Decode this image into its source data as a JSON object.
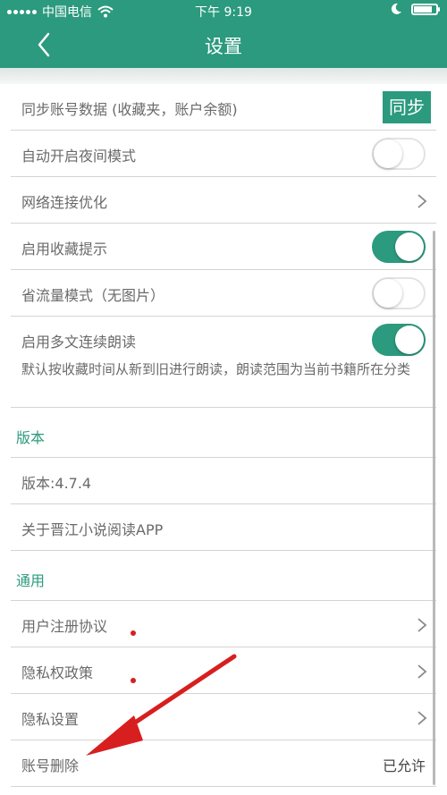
{
  "status": {
    "carrier": "中国电信",
    "time": "下午 9:19"
  },
  "nav": {
    "title": "设置"
  },
  "settings": {
    "sync_account": "同步账号数据 (收藏夹，账户余额)",
    "sync_button": "同步",
    "night_mode": "自动开启夜间模式",
    "night_mode_on": false,
    "network_opt": "网络连接优化",
    "fav_hint": "启用收藏提示",
    "fav_hint_on": true,
    "data_saver": "省流量模式（无图片）",
    "data_saver_on": false,
    "continuous_read": "启用多文连续朗读",
    "continuous_read_on": true,
    "continuous_read_desc": "默认按收藏时间从新到旧进行朗读，朗读范围为当前书籍所在分类"
  },
  "version_section": {
    "header": "版本",
    "version": "版本:4.7.4",
    "about": "关于晋江小说阅读APP"
  },
  "general_section": {
    "header": "通用",
    "user_agreement": "用户注册协议",
    "privacy_policy": "隐私权政策",
    "privacy_settings": "隐私设置",
    "account_delete": "账号删除",
    "account_delete_status": "已允许"
  },
  "colors": {
    "brand": "#2c9a7e",
    "annotation": "#d71f1f"
  }
}
